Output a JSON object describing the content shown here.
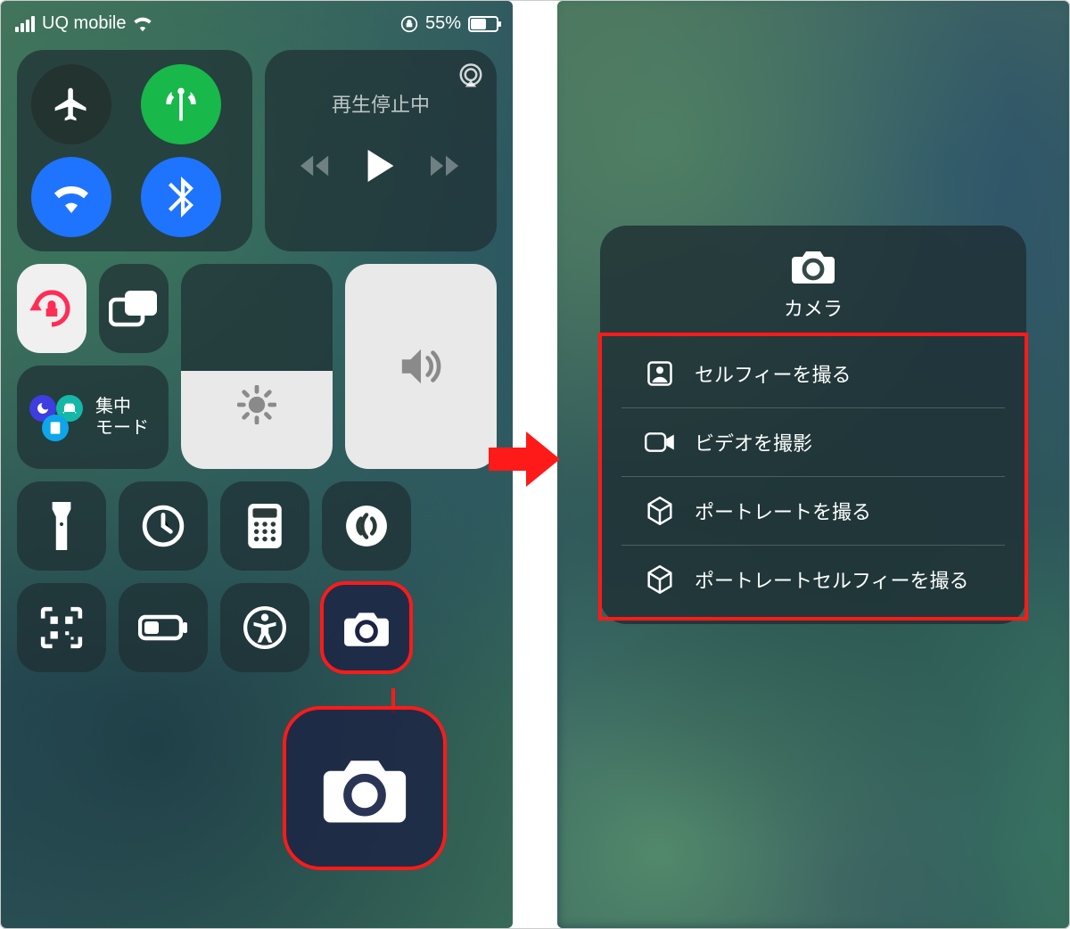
{
  "statusbar": {
    "carrier": "UQ mobile",
    "battery_pct": "55%"
  },
  "media": {
    "title": "再生停止中"
  },
  "focus": {
    "label_l1": "集中",
    "label_l2": "モード"
  },
  "camera_menu": {
    "title": "カメラ",
    "items": [
      {
        "label": "セルフィーを撮る",
        "icon": "selfie-icon"
      },
      {
        "label": "ビデオを撮影",
        "icon": "video-icon"
      },
      {
        "label": "ポートレートを撮る",
        "icon": "cube-icon"
      },
      {
        "label": "ポートレートセルフィーを撮る",
        "icon": "cube-icon"
      }
    ]
  }
}
